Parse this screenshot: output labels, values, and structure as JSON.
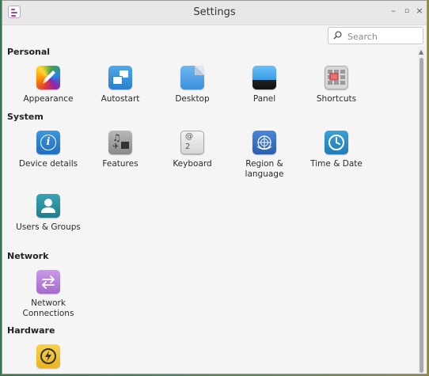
{
  "window": {
    "title": "Settings"
  },
  "search": {
    "placeholder": "Search"
  },
  "sections": [
    {
      "title": "Personal",
      "items": [
        {
          "label": "Appearance",
          "icon": "appearance-icon"
        },
        {
          "label": "Autostart",
          "icon": "autostart-icon"
        },
        {
          "label": "Desktop",
          "icon": "desktop-icon"
        },
        {
          "label": "Panel",
          "icon": "panel-icon"
        },
        {
          "label": "Shortcuts",
          "icon": "shortcuts-icon"
        }
      ]
    },
    {
      "title": "System",
      "items": [
        {
          "label": "Device details",
          "icon": "info-icon"
        },
        {
          "label": "Features",
          "icon": "features-icon"
        },
        {
          "label": "Keyboard",
          "icon": "keyboard-icon"
        },
        {
          "label": "Region & language",
          "icon": "globe-icon"
        },
        {
          "label": "Time & Date",
          "icon": "clock-icon"
        },
        {
          "label": "Users & Groups",
          "icon": "user-icon"
        }
      ]
    },
    {
      "title": "Network",
      "items": [
        {
          "label": "Network Connections",
          "icon": "network-icon"
        }
      ]
    },
    {
      "title": "Hardware",
      "items": [
        {
          "label": "",
          "icon": "power-icon"
        }
      ]
    }
  ],
  "keyboard_icon_text": {
    "top": "@",
    "bottom": "2"
  },
  "colors": {
    "window_bg": "#f5f5f5",
    "info_blue": "#2a7cc7",
    "clock_blue": "#2a8bc0",
    "user_teal": "#2a8a9a",
    "network_purple": "#b57fd6",
    "power_yellow": "#f2c230"
  }
}
